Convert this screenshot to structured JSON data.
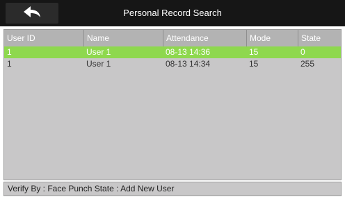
{
  "header": {
    "title": "Personal Record Search",
    "back_icon": "back-arrow-icon"
  },
  "table": {
    "columns": [
      "User ID",
      "Name",
      "Attendance",
      "Mode",
      "State"
    ],
    "rows": [
      {
        "user_id": "1",
        "name": "User 1",
        "attendance": "08-13 14:36",
        "mode": "15",
        "state": "0",
        "selected": true
      },
      {
        "user_id": "1",
        "name": "User 1",
        "attendance": "08-13 14:34",
        "mode": "15",
        "state": "255",
        "selected": false
      }
    ]
  },
  "status": {
    "text": "Verify By : Face   Punch State : Add New User"
  },
  "colors": {
    "titlebar": "#161616",
    "selected_row": "#8ed84e",
    "table_bg": "#c8c7c8",
    "header_bg": "#b3b3b3"
  }
}
